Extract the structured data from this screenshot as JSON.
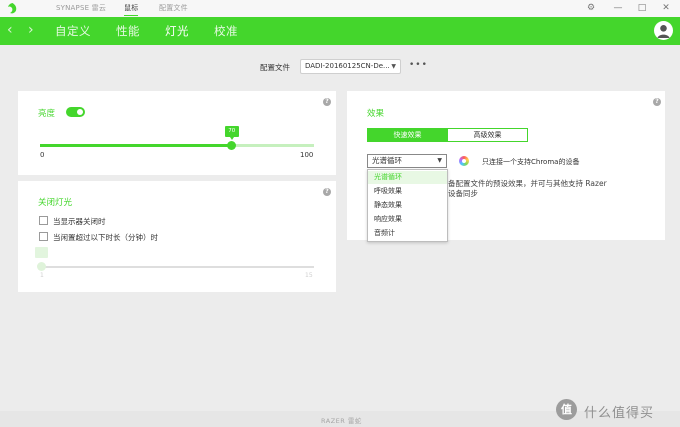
{
  "titlebar": {
    "tabs": [
      "SYNAPSE 雷云",
      "鼠标",
      "配置文件"
    ],
    "active_tab": "鼠标",
    "controls": {
      "settings": "⚙",
      "minimize": "—",
      "maximize": "□",
      "close": "✕"
    }
  },
  "navbar": {
    "back": "‹",
    "forward": "›",
    "tabs": [
      "自定义",
      "性能",
      "灯光",
      "校准"
    ],
    "active_tab": "灯光"
  },
  "profile": {
    "label": "配置文件",
    "value": "DADI-20160125CN-De...",
    "more": "•••"
  },
  "brightness": {
    "title": "亮度",
    "toggle_on": true,
    "value": 70,
    "value_label": "70",
    "min": "0",
    "max": "100"
  },
  "lights_off": {
    "title": "关闭灯光",
    "option_display_off": "当显示器关闭时",
    "option_idle": "当闲置超过以下时长（分钟）时",
    "slider_min": "1",
    "slider_max": "15"
  },
  "effects": {
    "title": "效果",
    "quick_effects": "快速效果",
    "advanced_effects": "高级效果",
    "selected_effect": "光谱循环",
    "chroma_note": "只连接一个支持Chroma的设备",
    "description_line1": "备配置文件的预设效果，并可与其他支持 Razer",
    "description_line2": "设备同步",
    "dropdown_options": [
      "光谱循环",
      "呼吸效果",
      "静态效果",
      "响应效果",
      "音频计"
    ]
  },
  "footer": {
    "text": "RAZER 雷蛇"
  },
  "watermark": {
    "icon": "值",
    "text": "什么值得买"
  },
  "colors": {
    "accent": "#44d62c",
    "background": "#ececec",
    "panel": "#ffffff"
  }
}
